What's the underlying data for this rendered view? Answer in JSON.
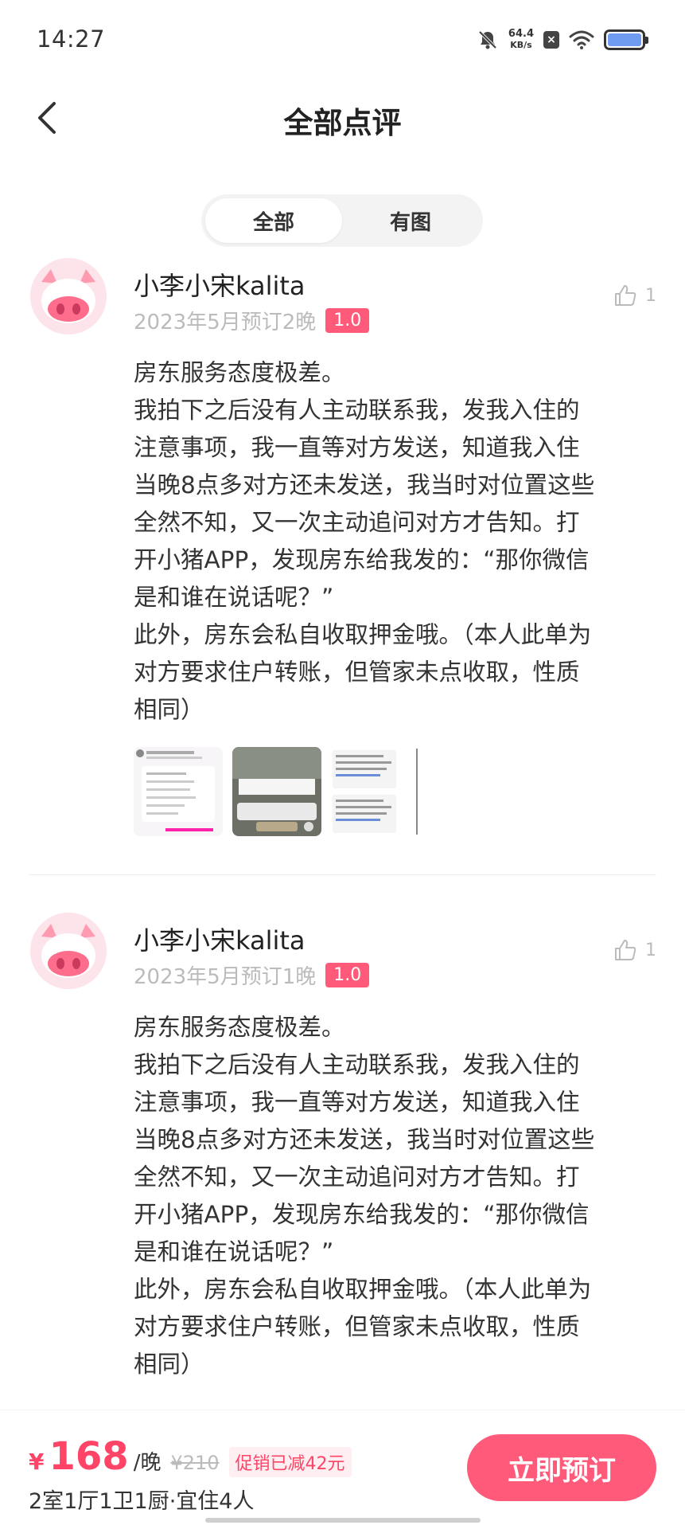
{
  "status": {
    "time": "14:27",
    "speed": "64.4",
    "speed_unit": "KB/s"
  },
  "nav": {
    "title": "全部点评"
  },
  "tabs": [
    {
      "label": "全部",
      "active": true
    },
    {
      "label": "有图",
      "active": false
    }
  ],
  "reviews": [
    {
      "name": "小李小宋kalita",
      "date": "2023年5月预订2晚",
      "score": "1.0",
      "likes": "1",
      "lines": [
        "房东服务态度极差。",
        "我拍下之后没有人主动联系我，发我入住的",
        "注意事项，我一直等对方发送，知道我入住",
        "当晚8点多对方还未发送，我当时对位置这些",
        "全然不知，又一次主动追问对方才告知。打",
        "开小猪APP，发现房东给我发的：“那你微信",
        "是和谁在说话呢？”",
        "此外，房东会私自收取押金哦。（本人此单为",
        "对方要求住户转账，但管家未点收取，性质",
        "相同）"
      ]
    },
    {
      "name": "小李小宋kalita",
      "date": "2023年5月预订1晚",
      "score": "1.0",
      "likes": "1",
      "lines": [
        "房东服务态度极差。",
        "我拍下之后没有人主动联系我，发我入住的",
        "注意事项，我一直等对方发送，知道我入住",
        "当晚8点多对方还未发送，我当时对位置这些",
        "全然不知，又一次主动追问对方才告知。打",
        "开小猪APP，发现房东给我发的：“那你微信",
        "是和谁在说话呢？”",
        "此外，房东会私自收取押金哦。（本人此单为",
        "对方要求住户转账，但管家未点收取，性质",
        "相同）"
      ]
    }
  ],
  "bottom": {
    "currency": "¥",
    "price": "168",
    "unit": "/晚",
    "old_price": "¥210",
    "promo": "促销已减42元",
    "room": "2室1厅1卫1厨·宜住4人",
    "book_label": "立即预订"
  },
  "colors": {
    "accent": "#ff5a79",
    "price": "#ff4467"
  }
}
